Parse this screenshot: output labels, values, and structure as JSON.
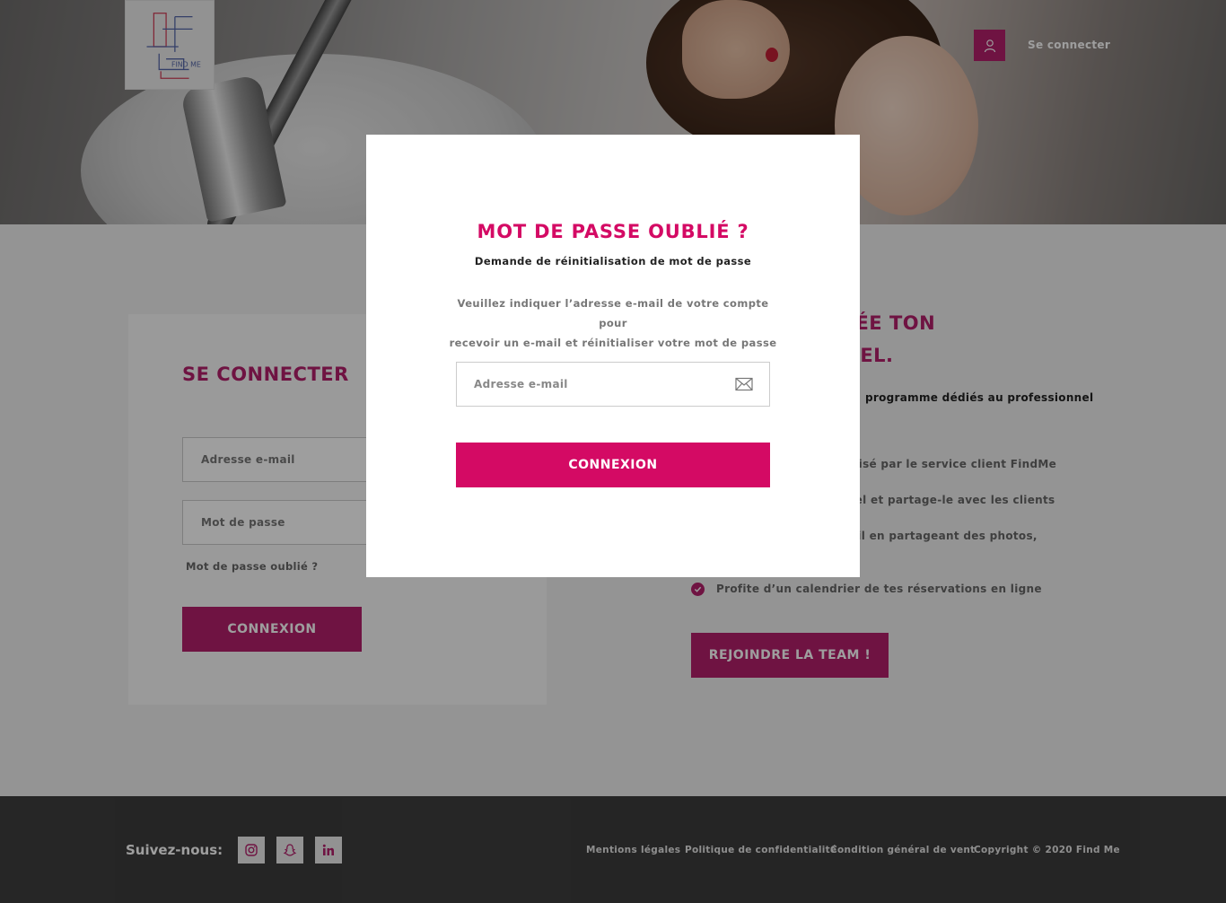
{
  "header": {
    "logo_text": "FIND ME",
    "signin_label": "Se connecter"
  },
  "login": {
    "title": "SE CONNECTER",
    "email_placeholder": "Adresse e-mail",
    "password_placeholder": "Mot de passe",
    "forgot_link": "Mot de passe oublié ?",
    "submit_label": "CONNEXION"
  },
  "pro": {
    "title_line1": "OME.  CRÉE TON",
    "title_line2": "IEL.",
    "intro": "programme dédiés au professionnel",
    "benefits": [
      "nalisé par le service client FindMe",
      "nnel et partage-le avec les clients",
      "rofil en partageant des photos,",
      "Profite d’un calendrier de tes réservations en ligne"
    ],
    "cta_label": "REJOINDRE LA TEAM !"
  },
  "footer": {
    "follow_label": "Suivez-nous:",
    "social": [
      "instagram-icon",
      "snapchat-icon",
      "linkedin-icon"
    ],
    "links": [
      "Mentions légales",
      "Politique de confidentialité",
      "Condition général de vent"
    ],
    "copyright": "Copyright © 2020 Find Me"
  },
  "modal": {
    "title": "MOT DE PASSE OUBLIÉ ?",
    "subtitle": "Demande de réinitialisation de mot de passe",
    "desc_line1": "Veuillez indiquer l’adresse e-mail de votre compte pour",
    "desc_line2": "recevoir un e-mail et réinitialiser votre mot de passe",
    "email_placeholder": "Adresse e-mail",
    "submit_label": "CONNEXION"
  },
  "colors": {
    "brand": "#b3206b",
    "modal_accent": "#d40a64",
    "footer_bg": "#3d3d3d"
  }
}
